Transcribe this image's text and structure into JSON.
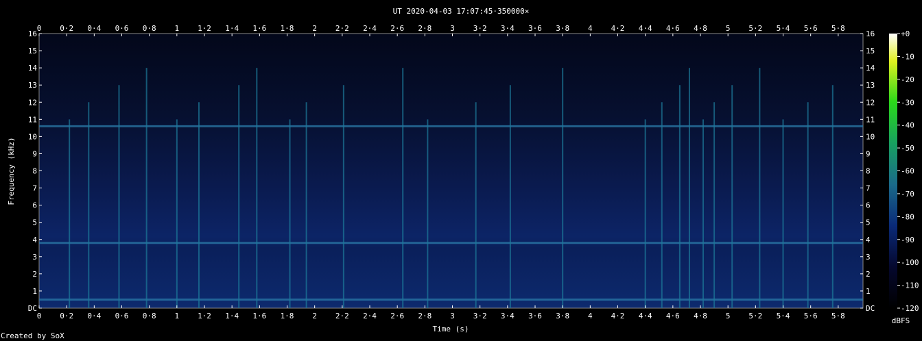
{
  "chart_data": {
    "type": "heatmap",
    "title": "UT 2020-04-03 17:07:45·350000×",
    "xlabel": "Time (s)",
    "ylabel": "Frequency (kHz)",
    "x_ticks": [
      "0",
      "0·2",
      "0·4",
      "0·6",
      "0·8",
      "1",
      "1·2",
      "1·4",
      "1·6",
      "1·8",
      "2",
      "2·2",
      "2·4",
      "2·6",
      "2·8",
      "3",
      "3·2",
      "3·4",
      "3·6",
      "3·8",
      "4",
      "4·2",
      "4·4",
      "4·6",
      "4·8",
      "5",
      "5·2",
      "5·4",
      "5·6",
      "5·8"
    ],
    "y_ticks": [
      "DC",
      "1",
      "2",
      "3",
      "4",
      "5",
      "6",
      "7",
      "8",
      "9",
      "10",
      "11",
      "12",
      "13",
      "14",
      "15",
      "16"
    ],
    "xlim": [
      0,
      5.98
    ],
    "ylim": [
      0,
      16
    ],
    "colorbar": {
      "label": "dBFS",
      "ticks": [
        "+0",
        "-10",
        "-20",
        "-30",
        "-40",
        "-50",
        "-60",
        "-70",
        "-80",
        "-90",
        "-100",
        "-110",
        "-120"
      ],
      "range": [
        -120,
        0
      ]
    },
    "features": {
      "horizontal_lines_khz": [
        0.5,
        3.8,
        10.6
      ],
      "impulse_times_s": [
        0.22,
        0.36,
        0.58,
        0.78,
        1.0,
        1.16,
        1.45,
        1.58,
        1.82,
        1.94,
        2.21,
        2.64,
        2.82,
        3.17,
        3.42,
        3.8,
        4.4,
        4.52,
        4.65,
        4.72,
        4.82,
        4.9,
        5.03,
        5.23,
        5.4,
        5.58,
        5.76
      ]
    }
  },
  "colors": {
    "background": "#000000",
    "spectrum_base": "#0a1a4a",
    "spectrum_hot": "#1a8a9a"
  },
  "footer": {
    "credit": "Created by SoX"
  }
}
